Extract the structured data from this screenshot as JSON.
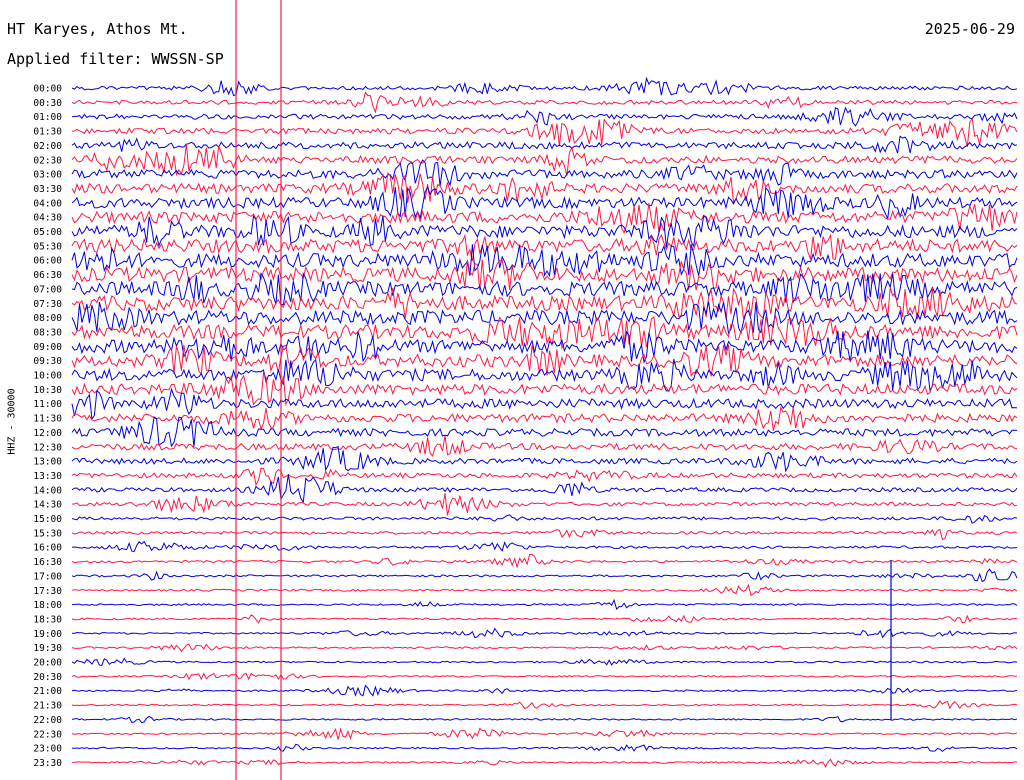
{
  "header": {
    "station": "HT Karyes, Athos Mt.",
    "filter": "Applied filter: WWSSN-SP",
    "date": "2025-06-29"
  },
  "axis": {
    "channel_label": "HHZ - 30000"
  },
  "colors": {
    "trace_a": "#0000e0",
    "trace_b": "#ff1744",
    "background": "#ffffff"
  },
  "times": [
    "00:00",
    "00:30",
    "01:00",
    "01:30",
    "02:00",
    "02:30",
    "03:00",
    "03:30",
    "04:00",
    "04:30",
    "05:00",
    "05:30",
    "06:00",
    "06:30",
    "07:00",
    "07:30",
    "08:00",
    "08:30",
    "09:00",
    "09:30",
    "10:00",
    "10:30",
    "11:00",
    "11:30",
    "12:00",
    "12:30",
    "13:00",
    "13:30",
    "14:00",
    "14:30",
    "15:00",
    "15:30",
    "16:00",
    "16:30",
    "17:00",
    "17:30",
    "18:00",
    "18:30",
    "19:00",
    "19:30",
    "20:00",
    "20:30",
    "21:00",
    "21:30",
    "22:00",
    "22:30",
    "23:00",
    "23:30"
  ]
}
